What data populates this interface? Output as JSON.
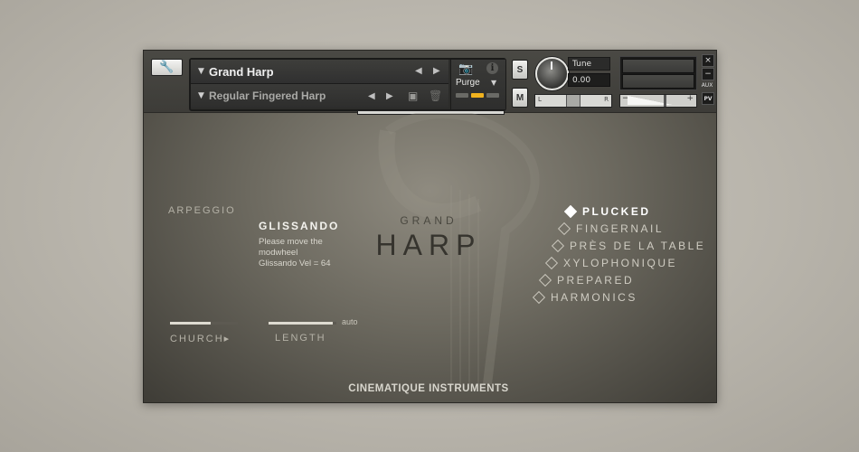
{
  "header": {
    "instrument_name": "Grand Harp",
    "patch_name": "Regular Fingered Harp",
    "purge_label": "Purge",
    "tune_label": "Tune",
    "tune_value": "0.00",
    "solo_label": "S",
    "mute_label": "M",
    "pan_left": "L",
    "pan_right": "R",
    "vol_minus": "−",
    "vol_plus": "+",
    "close_label": "×",
    "minimize_label": "−",
    "aux_label": "AUX",
    "pv_label": "PV"
  },
  "main": {
    "title_top": "GRAND",
    "title_main": "HARP",
    "arpeggio_label": "ARPEGGIO",
    "glissando_label": "GLISSANDO",
    "glissando_desc_1": "Please move the",
    "glissando_desc_2": "modwheel",
    "glissando_desc_3": "Glissando Vel = 64",
    "church_label": "CHURCH▸",
    "length_label": "LENGTH",
    "auto_label": "auto",
    "articulations": [
      {
        "label": "PLUCKED",
        "selected": true
      },
      {
        "label": "FINGERNAIL",
        "selected": false
      },
      {
        "label": "PRÈS DE LA TABLE",
        "selected": false
      },
      {
        "label": "XYLOPHONIQUE",
        "selected": false
      },
      {
        "label": "PREPARED",
        "selected": false
      },
      {
        "label": "HARMONICS",
        "selected": false
      }
    ],
    "church_level": 0.6,
    "length_level": 0.95,
    "brand": "CINEMATIQUE INSTRUMENTS"
  },
  "colors": {
    "led_active": "#f0b21e",
    "panel_bg": "#6c695f"
  }
}
